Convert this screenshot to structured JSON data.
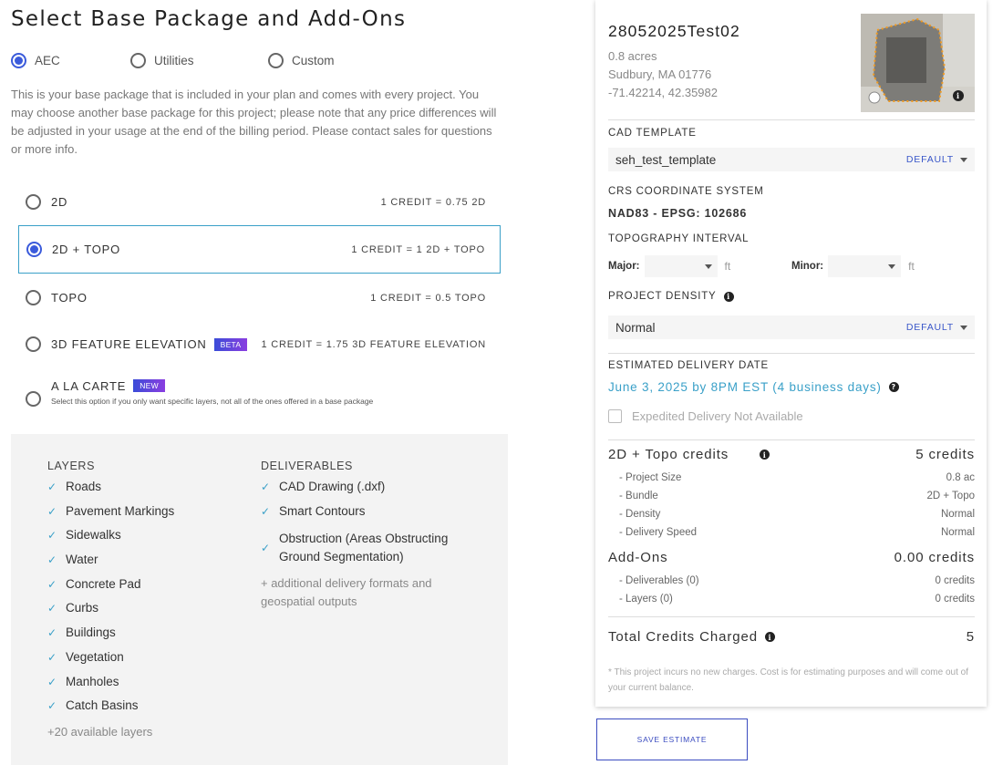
{
  "page": {
    "title": "Select Base Package and Add-Ons"
  },
  "base_types": [
    {
      "label": "AEC",
      "selected": true
    },
    {
      "label": "Utilities",
      "selected": false
    },
    {
      "label": "Custom",
      "selected": false
    }
  ],
  "description": "This is your base package that is included in your plan and comes with every project. You may choose another base package for this project; please note that any price differences will be adjusted in your usage at the end of the billing period. Please contact sales for questions or more info.",
  "packages": [
    {
      "name": "2D",
      "credit": "1 CREDIT = 0.75 2D",
      "selected": false
    },
    {
      "name": "2D + TOPO",
      "credit": "1 CREDIT = 1 2D + TOPO",
      "selected": true
    },
    {
      "name": "TOPO",
      "credit": "1 CREDIT = 0.5 TOPO",
      "selected": false
    },
    {
      "name": "3D FEATURE ELEVATION",
      "tag": "BETA",
      "credit": "1 CREDIT = 1.75 3D FEATURE ELEVATION",
      "selected": false
    },
    {
      "name": "A LA CARTE",
      "tag": "NEW",
      "sub": "Select this option if you only want specific layers, not all of the ones offered in a base package",
      "selected": false
    }
  ],
  "layers": {
    "heading": "LAYERS",
    "items": [
      "Roads",
      "Pavement Markings",
      "Sidewalks",
      "Water",
      "Concrete Pad",
      "Curbs",
      "Buildings",
      "Vegetation",
      "Manholes",
      "Catch Basins"
    ],
    "more": "+20 available layers"
  },
  "deliverables": {
    "heading": "DELIVERABLES",
    "items": [
      "CAD Drawing (.dxf)",
      "Smart Contours",
      "Obstruction (Areas Obstructing Ground Segmentation)"
    ],
    "more": "+ additional delivery formats and geospatial outputs"
  },
  "project": {
    "name": "28052025Test02",
    "acres": "0.8 acres",
    "address": "Sudbury, MA 01776",
    "coords": "-71.42214, 42.35982"
  },
  "cad_template": {
    "label": "CAD TEMPLATE",
    "value": "seh_test_template",
    "default": "DEFAULT"
  },
  "crs": {
    "label": "CRS COORDINATE SYSTEM",
    "value": "NAD83 - EPSG: 102686"
  },
  "topo": {
    "label": "TOPOGRAPHY INTERVAL",
    "major_label": "Major:",
    "minor_label": "Minor:",
    "unit": "ft"
  },
  "density": {
    "label": "PROJECT DENSITY",
    "value": "Normal",
    "default": "DEFAULT"
  },
  "delivery": {
    "label": "ESTIMATED DELIVERY DATE",
    "value": "June 3, 2025 by 8PM EST (4 business days)",
    "expedited": "Expedited Delivery Not Available"
  },
  "credits": {
    "base_label": "2D + Topo credits",
    "base_value": "5 credits",
    "rows": [
      {
        "label": "- Project Size",
        "value": "0.8 ac"
      },
      {
        "label": "- Bundle",
        "value": "2D + Topo"
      },
      {
        "label": "- Density",
        "value": "Normal"
      },
      {
        "label": "- Delivery Speed",
        "value": "Normal"
      }
    ],
    "addons_label": "Add-Ons",
    "addons_value": "0.00 credits",
    "addon_rows": [
      {
        "label": "- Deliverables (0)",
        "value": "0 credits"
      },
      {
        "label": "- Layers (0)",
        "value": "0 credits"
      }
    ],
    "total_label": "Total Credits Charged",
    "total_value": "5"
  },
  "footnote": "* This project incurs no new charges. Cost is for estimating purposes and will come out of your current balance.",
  "save_label": "SAVE ESTIMATE",
  "colors": {
    "accent": "#3b5bdb",
    "link": "#3aa0c8",
    "button": "#3b4cc0"
  }
}
